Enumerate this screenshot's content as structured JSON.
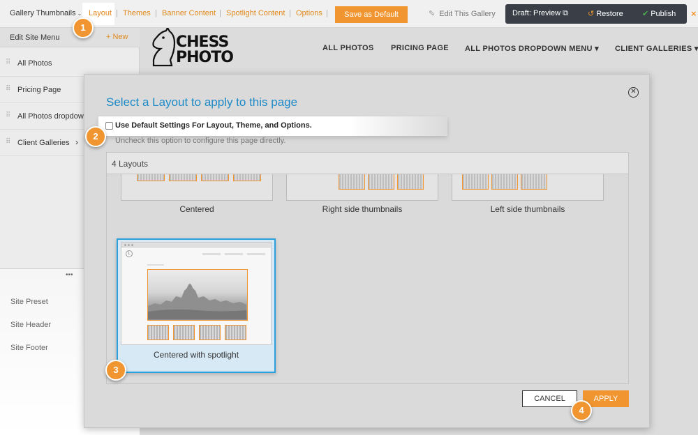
{
  "toolbar": {
    "gallery_label": "Gallery Thumbnails",
    "links": [
      "Layout",
      "Themes",
      "Banner Content",
      "Spotlight Content",
      "Options"
    ],
    "save_default": "Save as Default",
    "edit_gallery": "Edit This Gallery",
    "draft_preview": "Draft: Preview",
    "restore": "Restore",
    "publish": "Publish",
    "close": "×"
  },
  "sidebar": {
    "title": "Edit Site Menu",
    "new_label": "+ New",
    "items": [
      "All Photos",
      "Pricing Page",
      "All Photos dropdown",
      "Client Galleries"
    ],
    "lower_items": [
      "Site Preset",
      "Site Header",
      "Site Footer"
    ]
  },
  "site": {
    "logo_line1": "CHESS",
    "logo_line2": "PHOTO",
    "nav": [
      "ALL PHOTOS",
      "PRICING PAGE",
      "ALL PHOTOS DROPDOWN MENU ▾",
      "CLIENT GALLERIES ▾"
    ]
  },
  "modal": {
    "title": "Select a Layout to apply to this page",
    "checkbox_label": "Use Default Settings For Layout, Theme, and Options.",
    "help_text": "Uncheck this option to configure this page directly.",
    "layouts_count": "4 Layouts",
    "layouts": [
      "Centered",
      "Right side thumbnails",
      "Left side thumbnails",
      "Centered with spotlight"
    ],
    "cancel": "CANCEL",
    "apply": "APPLY"
  },
  "badges": [
    "1",
    "2",
    "3",
    "4"
  ],
  "colors": {
    "accent": "#f0952f",
    "title_blue": "#1d8ac8",
    "selected_border": "#2ca0dc",
    "dark_bar": "#3a3f47"
  }
}
